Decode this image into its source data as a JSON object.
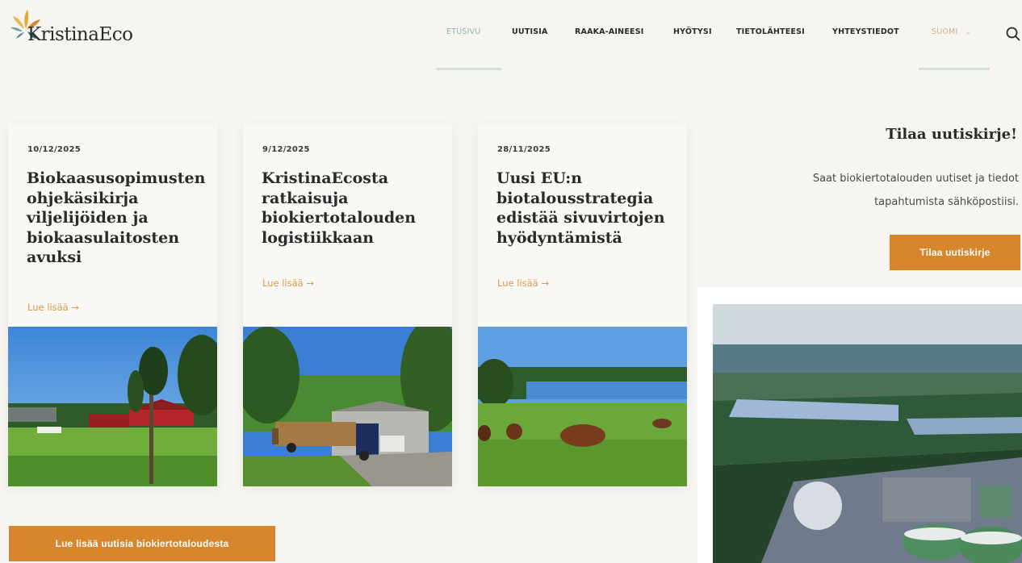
{
  "brand": {
    "name": "KristinaEco",
    "accent": "#d8862b",
    "teal": "#8eb3ad"
  },
  "nav": {
    "items": [
      {
        "label": "ETUSIVU",
        "active": true
      },
      {
        "label": "UUTISIA"
      },
      {
        "label": "RAAKA-AINEESI"
      },
      {
        "label": "HYÖTYSI"
      },
      {
        "label": "TIETOLÄHTEESI"
      },
      {
        "label": "YHTEYSTIEDOT"
      }
    ],
    "language": "SUOMI",
    "search_icon": "search-icon"
  },
  "cards": [
    {
      "date": "10/12/2025",
      "title": "Biokaasusopimusten ohjekäsikirja viljelijöiden ja biokaasulaitosten avuksi",
      "link": "Lue lisää →",
      "image": "farm-landscape"
    },
    {
      "date": "9/12/2025",
      "title": "KristinaEcosta ratkaisuja biokiertotalouden logistiikkaan",
      "link": "Lue lisää →",
      "image": "timber-truck"
    },
    {
      "date": "28/11/2025",
      "title": "Uusi EU:n biotalousstrategia edistää sivuvirtojen hyödyntämistä",
      "link": "Lue lisää →",
      "image": "cows-pasture"
    }
  ],
  "newsletter": {
    "title": "Tilaa uutiskirje!",
    "text": "Saat biokiertotalouden uutiset ja tiedot tapahtumista sähköpostiisi.",
    "button": "Tilaa uutiskirje"
  },
  "more_button": "Lue lisää uutisia biokiertotaloudesta"
}
